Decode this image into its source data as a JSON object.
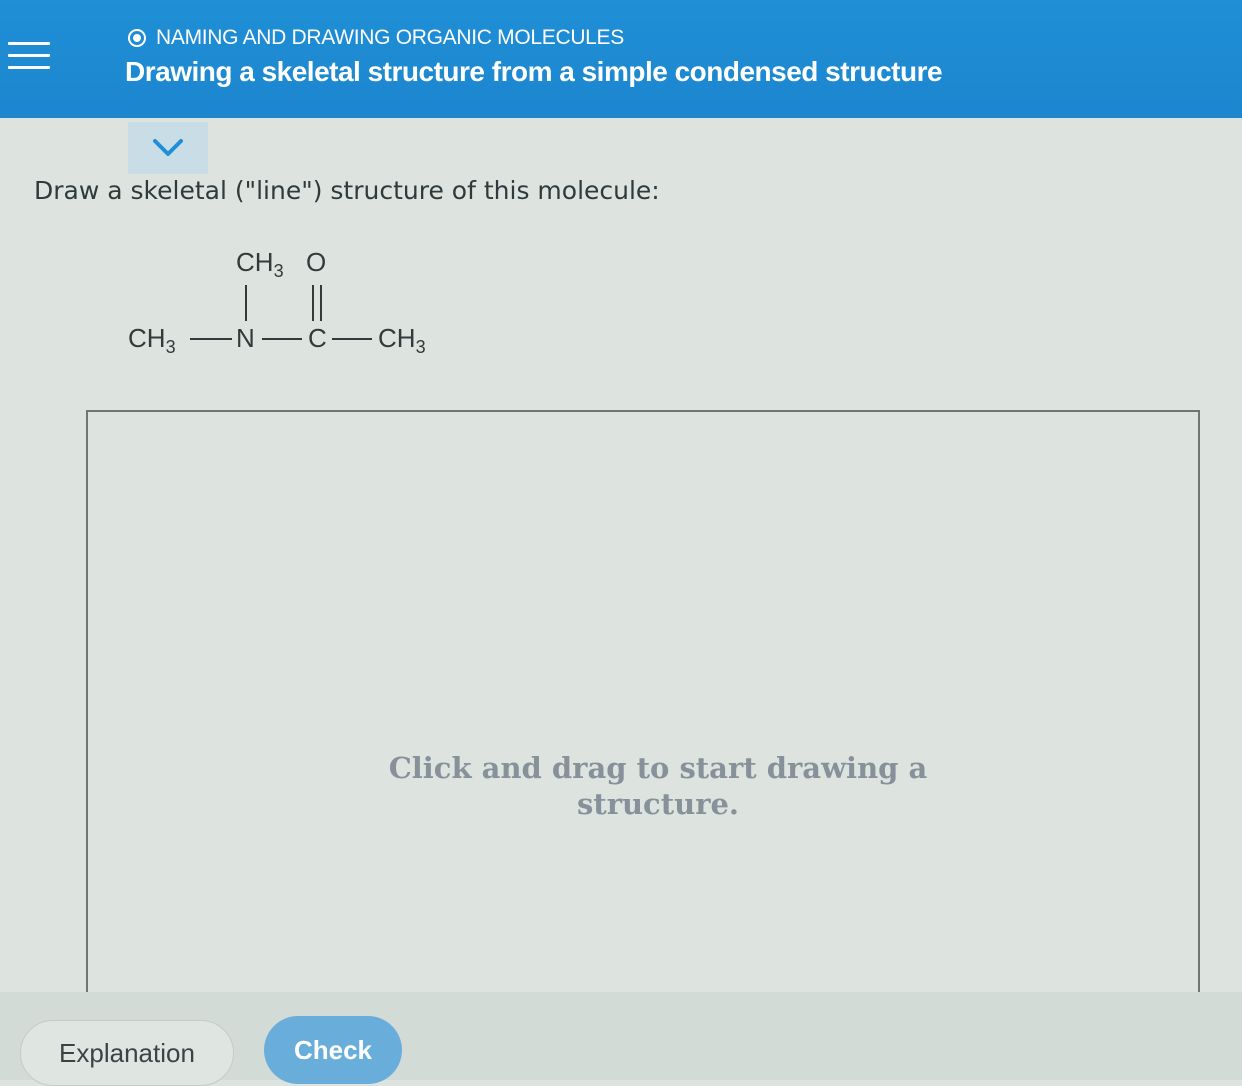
{
  "header": {
    "topic": "NAMING AND DRAWING ORGANIC MOLECULES",
    "title": "Drawing a skeletal structure from a simple condensed structure",
    "color": "#1f8fd6"
  },
  "question": {
    "prompt": "Draw a skeletal (\"line\") structure of this molecule:"
  },
  "molecule": {
    "atoms": {
      "ch3_left": "CH",
      "ch3_left_sub": "3",
      "n": "N",
      "c": "C",
      "ch3_right": "CH",
      "ch3_right_sub": "3",
      "ch3_top": "CH",
      "ch3_top_sub": "3",
      "o": "O"
    }
  },
  "canvas": {
    "hint": "Click and drag to start drawing a structure."
  },
  "buttons": {
    "explanation": "Explanation",
    "check": "Check",
    "check_color": "#69aedb"
  },
  "icons": {
    "menu": "hamburger-menu-icon",
    "topic": "topic-circle-icon",
    "collapse": "chevron-down-icon"
  }
}
